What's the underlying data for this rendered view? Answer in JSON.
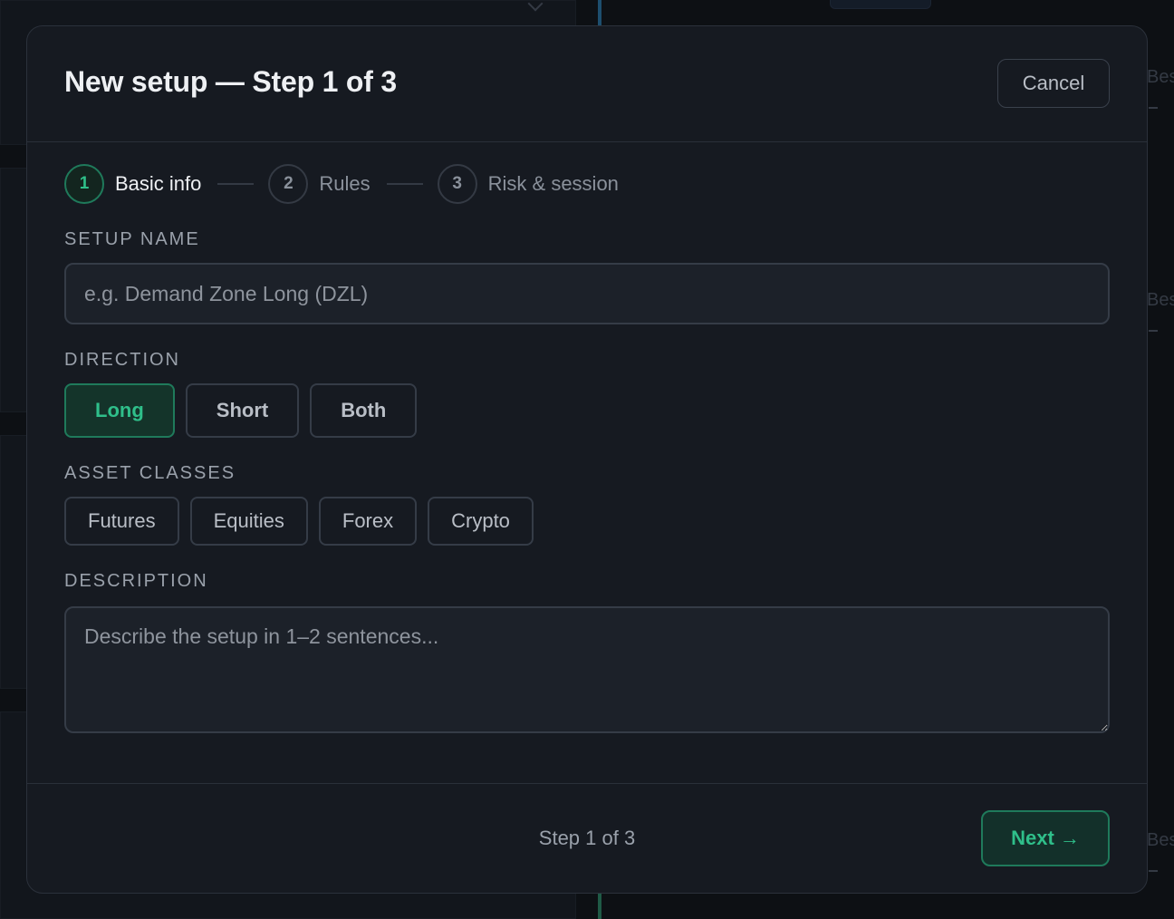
{
  "modal": {
    "title": "New setup — Step 1 of 3",
    "cancel_label": "Cancel"
  },
  "stepper": [
    {
      "number": "1",
      "label": "Basic info",
      "active": true
    },
    {
      "number": "2",
      "label": "Rules",
      "active": false
    },
    {
      "number": "3",
      "label": "Risk & session",
      "active": false
    }
  ],
  "fields": {
    "setup_name": {
      "label": "SETUP NAME",
      "placeholder": "e.g. Demand Zone Long (DZL)",
      "value": ""
    },
    "direction": {
      "label": "DIRECTION",
      "options": [
        "Long",
        "Short",
        "Both"
      ],
      "selected": "Long"
    },
    "asset_classes": {
      "label": "ASSET CLASSES",
      "options": [
        "Futures",
        "Equities",
        "Forex",
        "Crypto"
      ]
    },
    "description": {
      "label": "DESCRIPTION",
      "placeholder": "Describe the setup in 1–2 sentences...",
      "value": ""
    }
  },
  "footer": {
    "step_text": "Step 1 of 3",
    "next_label": "Next →"
  },
  "background": {
    "ghost_text": "Bes"
  },
  "colors": {
    "accent": "#2fbf8a",
    "accent_border": "#1f7a5b",
    "modal_bg": "#161a21",
    "page_bg": "#0e1116"
  }
}
